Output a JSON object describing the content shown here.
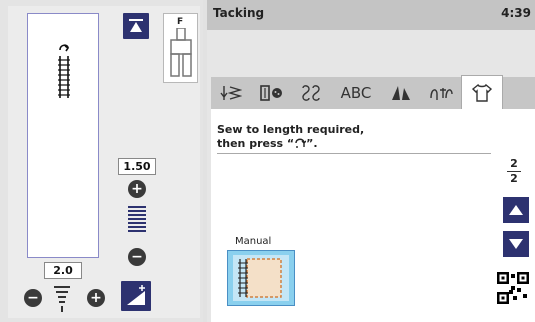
{
  "left_panel": {
    "foot_label": "F",
    "stitch_length": "1.50",
    "stitch_width": "2.0",
    "icons": {
      "auto_lock": "auto-lock-icon",
      "presser_foot": "presser-foot-icon",
      "length_plus": "plus-icon",
      "length_minus": "minus-icon",
      "width_plus": "plus-icon",
      "width_minus": "minus-icon",
      "alt_setting": "alternate-stitch-icon"
    }
  },
  "header": {
    "title": "Tacking",
    "time": "4:39"
  },
  "tabs": [
    {
      "label": "",
      "icon": "utility-stitch-icon"
    },
    {
      "label": "",
      "icon": "buttonhole-icon"
    },
    {
      "label": "",
      "icon": "decorative-stitch-icon"
    },
    {
      "label": "ABC",
      "icon": ""
    },
    {
      "label": "",
      "icon": "quilting-icon"
    },
    {
      "label": "",
      "icon": "combination-icon"
    },
    {
      "label": "",
      "icon": "shirt-icon"
    }
  ],
  "content": {
    "message_line1": "Sew to length required,",
    "message_line2": "then press",
    "message_symbol": "“",
    "message_end": "”.",
    "page_current": "2",
    "page_total": "2",
    "manual_label": "Manual"
  },
  "colors": {
    "accent": "#2d3270",
    "manual_fill": "#8ad0ee"
  }
}
